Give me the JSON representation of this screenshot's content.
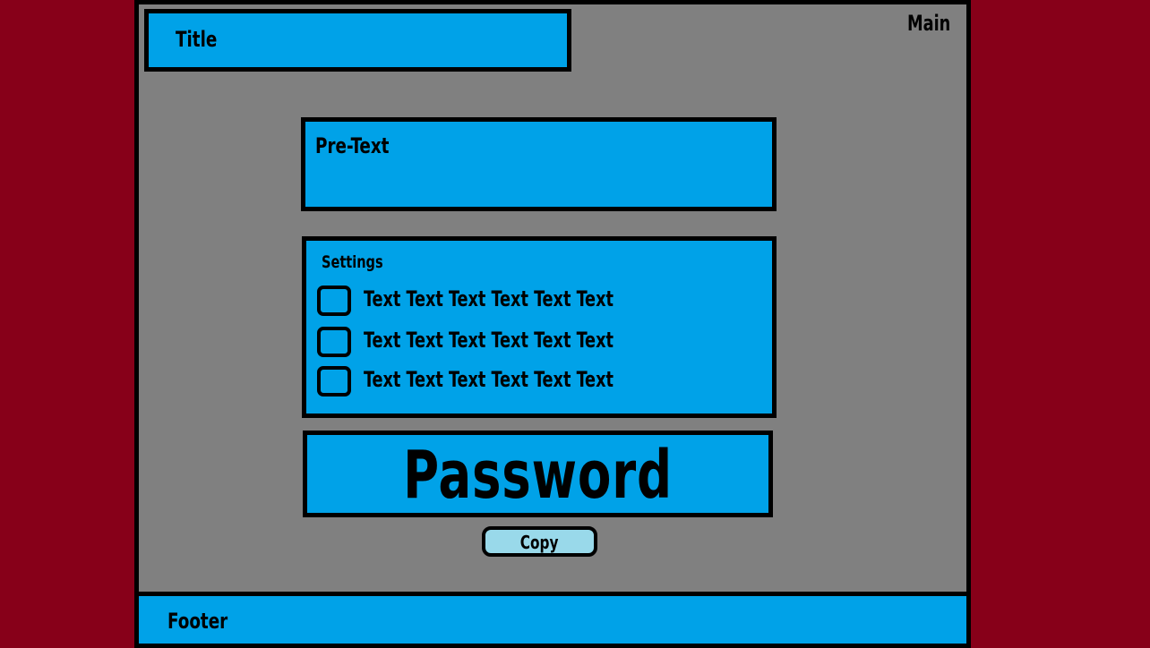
{
  "header": {
    "title": "Title",
    "main_label": "Main"
  },
  "pretext": {
    "label": "Pre-Text"
  },
  "settings": {
    "label": "Settings",
    "options": [
      {
        "label": "Text Text Text Text Text Text",
        "checked": false
      },
      {
        "label": "Text Text Text Text Text Text",
        "checked": false
      },
      {
        "label": "Text Text Text Text Text Text",
        "checked": false
      }
    ]
  },
  "password": {
    "value": "Password"
  },
  "actions": {
    "copy_label": "Copy"
  },
  "footer": {
    "label": "Footer"
  },
  "colors": {
    "background": "#870019",
    "panel": "#808080",
    "box": "#00a2e8",
    "button": "#99d9ea",
    "border": "#000000"
  }
}
